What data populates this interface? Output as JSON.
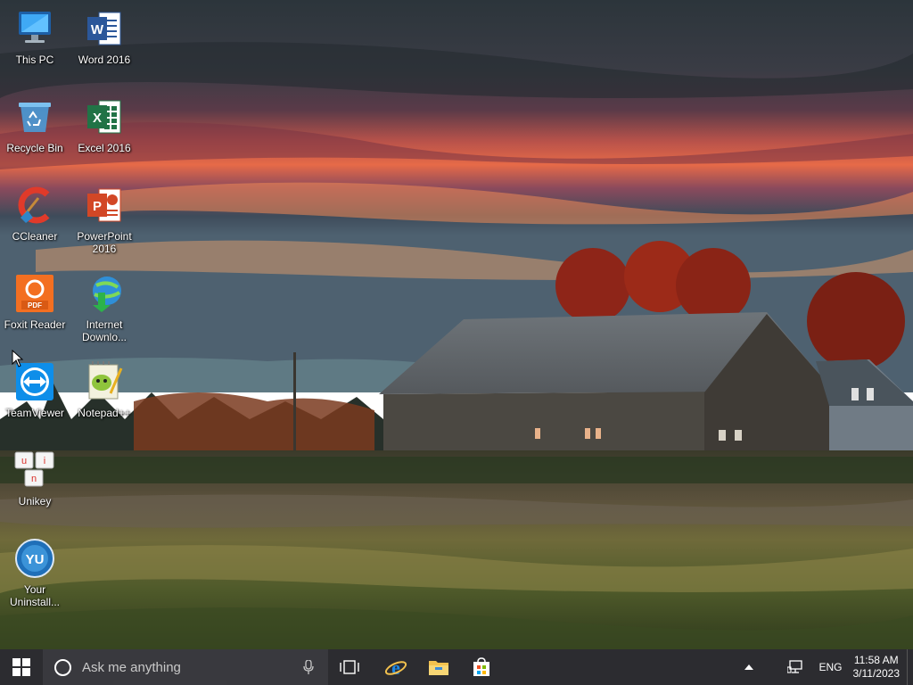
{
  "desktop": {
    "icons": [
      {
        "label": "This PC",
        "icon": "this-pc-icon"
      },
      {
        "label": "Word 2016",
        "icon": "word-icon"
      },
      {
        "label": "Recycle Bin",
        "icon": "recycle-bin-icon"
      },
      {
        "label": "Excel 2016",
        "icon": "excel-icon"
      },
      {
        "label": "CCleaner",
        "icon": "ccleaner-icon"
      },
      {
        "label": "PowerPoint 2016",
        "icon": "powerpoint-icon"
      },
      {
        "label": "Foxit Reader",
        "icon": "foxit-reader-icon"
      },
      {
        "label": "Internet Downlo...",
        "icon": "internet-download-manager-icon"
      },
      {
        "label": "TeamViewer",
        "icon": "teamviewer-icon"
      },
      {
        "label": "Notepad++",
        "icon": "notepad-plus-plus-icon"
      },
      {
        "label": "Unikey",
        "icon": "unikey-icon"
      },
      {
        "label": "Your Uninstall...",
        "icon": "your-uninstaller-icon"
      }
    ]
  },
  "taskbar": {
    "search_placeholder": "Ask me anything",
    "pinned": [
      {
        "name": "task-view",
        "icon": "task-view-icon"
      },
      {
        "name": "internet-explorer",
        "icon": "internet-explorer-icon"
      },
      {
        "name": "file-explorer",
        "icon": "file-explorer-icon"
      },
      {
        "name": "store",
        "icon": "store-icon"
      }
    ],
    "tray": {
      "language": "ENG",
      "time": "11:58 AM",
      "date": "3/11/2023"
    }
  },
  "colors": {
    "taskbar_bg": "#1a1a1e",
    "windows_accent": "#ffffff",
    "ie_blue": "#1e88e5",
    "folder_yellow": "#f2c14e"
  }
}
